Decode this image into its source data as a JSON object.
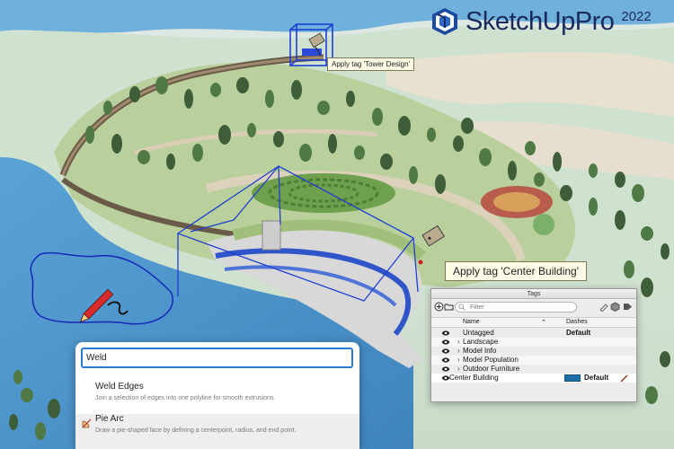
{
  "brand": {
    "name": "SketchUp",
    "edition": "Pro",
    "year": "2022"
  },
  "tooltips": {
    "small": "Apply tag 'Tower Design'",
    "large": "Apply tag 'Center Building'"
  },
  "search": {
    "query": "Weld",
    "results": [
      {
        "title": "Weld Edges",
        "description": "Join a selection of edges into one polyline for smooth extrusions.",
        "icon": "none"
      },
      {
        "title": "Pie Arc",
        "description": "Draw a pie-shaped face by defining a centerpoint, radius, and end point.",
        "icon": "pie-arc-icon"
      }
    ]
  },
  "tags": {
    "title": "Tags",
    "filter_placeholder": "Filter",
    "columns": {
      "name": "Name",
      "dashes": "Dashes"
    },
    "rows": [
      {
        "name": "Untagged",
        "expandable": false,
        "dashes": "Default",
        "color": ""
      },
      {
        "name": "Landscape",
        "expandable": true,
        "dashes": "",
        "color": ""
      },
      {
        "name": "Model Info",
        "expandable": true,
        "dashes": "",
        "color": ""
      },
      {
        "name": "Model Population",
        "expandable": true,
        "dashes": "",
        "color": ""
      },
      {
        "name": "Outdoor Furniture",
        "expandable": true,
        "dashes": "",
        "color": ""
      },
      {
        "name": "Center Building",
        "expandable": false,
        "dashes": "Default",
        "color": "#1d6fa8"
      }
    ]
  },
  "colors": {
    "accent": "#2a7bd1",
    "brand": "#1b2a5c",
    "selection": "#1f3fd1",
    "water": "#4f98cf"
  }
}
